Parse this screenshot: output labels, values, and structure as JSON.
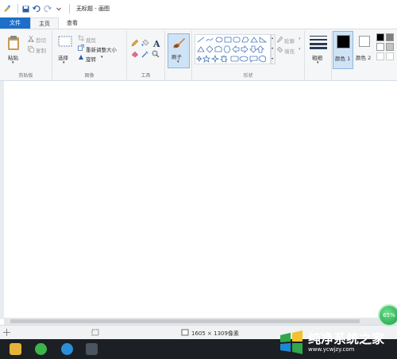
{
  "titlebar": {
    "title": "无标题 - 画图"
  },
  "tabs": [
    "文件",
    "主页",
    "查看"
  ],
  "ribbon": {
    "clipboard": {
      "paste": "粘贴",
      "cut": "剪切",
      "copy": "复制",
      "label": "剪贴板"
    },
    "image": {
      "select": "选择",
      "crop": "裁剪",
      "resize": "重新调整大小",
      "rotate": "旋转",
      "label": "图像"
    },
    "tools": {
      "label": "工具"
    },
    "brush": {
      "label": "刷子"
    },
    "shapes": {
      "outline": "轮廓",
      "fill": "填充",
      "label": "形状"
    },
    "size": {
      "label": "粗细"
    },
    "color1": {
      "label": "颜色 1"
    },
    "color2": {
      "label": "颜色 2"
    }
  },
  "status": {
    "dimensions": "1605 × 1309像素"
  },
  "badge": {
    "percent": "65%"
  },
  "watermark": {
    "title": "纯净系统之家",
    "url": "www.ycwjzy.com"
  },
  "colors": {
    "accent": "#1c6fc9",
    "color1": "#000000",
    "color2": "#ffffff"
  }
}
